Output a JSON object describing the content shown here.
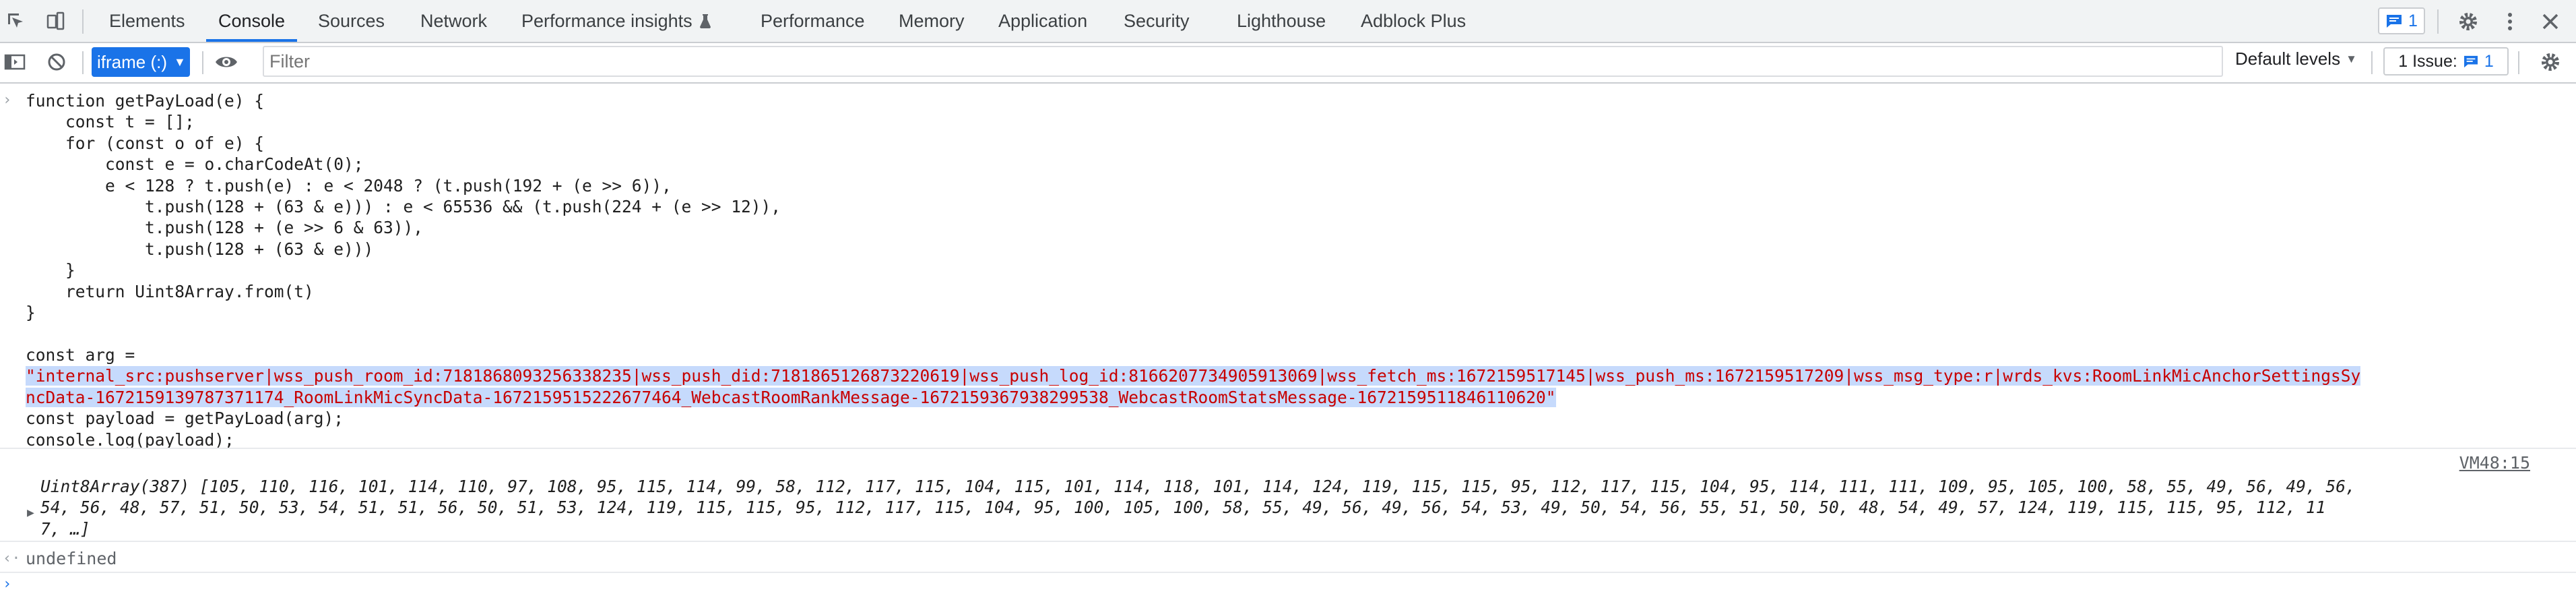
{
  "tabs": [
    "Elements",
    "Console",
    "Sources",
    "Network",
    "Performance insights",
    "Performance",
    "Memory",
    "Application",
    "Security",
    "Lighthouse",
    "Adblock Plus"
  ],
  "active_tab": "Console",
  "header": {
    "message_count": "1"
  },
  "toolbar": {
    "context": "iframe (:)",
    "filter_placeholder": "Filter",
    "levels_label": "Default levels",
    "issues_label": "1 Issue:",
    "issues_count": "1"
  },
  "console": {
    "code_lines": [
      "function getPayLoad(e) {",
      "    const t = [];",
      "    for (const o of e) {",
      "        const e = o.charCodeAt(0);",
      "        e < 128 ? t.push(e) : e < 2048 ? (t.push(192 + (e >> 6)),",
      "            t.push(128 + (63 & e))) : e < 65536 && (t.push(224 + (e >> 12)),",
      "            t.push(128 + (e >> 6 & 63)),",
      "            t.push(128 + (63 & e)))",
      "    }",
      "    return Uint8Array.from(t)",
      "}",
      "",
      "const arg =",
      "\"internal_src:pushserver|wss_push_room_id:7181868093256338235|wss_push_did:7181865126873220619|wss_push_log_id:8166207734905913069|wss_fetch_ms:1672159517145|wss_push_ms:1672159517209|wss_msg_type:r|wrds_kvs:RoomLinkMicAnchorSettingsSy",
      "ncData-1672159139787371174_RoomLinkMicSyncData-1672159515222677464_WebcastRoomRankMessage-1672159367938299538_WebcastRoomStatsMessage-1672159511846110620\"",
      "const payload = getPayLoad(arg);",
      "console.log(payload);"
    ],
    "source_link": "VM48:15",
    "result_lines": [
      "Uint8Array(387) [105, 110, 116, 101, 114, 110, 97, 108, 95, 115, 114, 99, 58, 112, 117, 115, 104, 115, 101, 114, 118, 101, 114, 124, 119, 115, 115, 95, 112, 117, 115, 104, 95, 114, 111, 111, 109, 95, 105, 100, 58, 55, 49, 56, 49, 56,",
      "54, 56, 48, 57, 51, 50, 53, 54, 51, 51, 56, 50, 51, 53, 124, 119, 115, 115, 95, 112, 117, 115, 104, 95, 100, 105, 100, 58, 55, 49, 56, 49, 56, 54, 53, 49, 50, 54, 56, 55, 51, 50, 50, 48, 54, 49, 57, 124, 119, 115, 115, 95, 112, 11",
      "7, …]"
    ],
    "return_value": "undefined"
  }
}
